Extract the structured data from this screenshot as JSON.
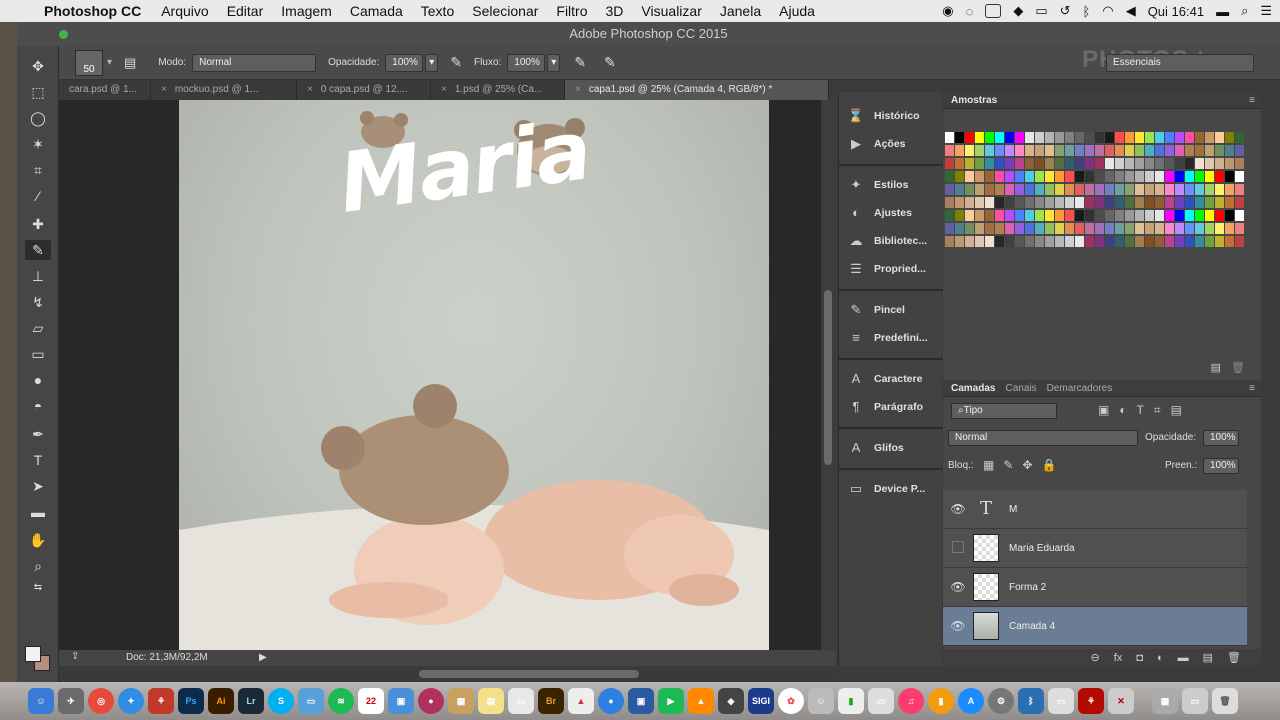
{
  "menubar": {
    "app": "Photoshop CC",
    "items": [
      "Arquivo",
      "Editar",
      "Imagem",
      "Camada",
      "Texto",
      "Selecionar",
      "Filtro",
      "3D",
      "Visualizar",
      "Janela",
      "Ajuda"
    ],
    "clock": "Qui 16:41"
  },
  "window": {
    "title": "Adobe Photoshop CC 2015"
  },
  "options": {
    "brush_size": "50",
    "mode_label": "Modo:",
    "mode_value": "Normal",
    "opacity_label": "Opacidade:",
    "opacity_value": "100%",
    "flow_label": "Fluxo:",
    "flow_value": "100%",
    "workspace": "Essenciais",
    "logo": "PHOTOS tv"
  },
  "tabs": [
    {
      "label": "cara.psd @ 1..."
    },
    {
      "label": "mockuo.psd @ 1..."
    },
    {
      "label": "0 capa.psd @ 12,..."
    },
    {
      "label": "1.psd @ 25% (Ca..."
    },
    {
      "label": "capa1.psd @ 25% (Camada 4, RGB/8*) *"
    }
  ],
  "canvas": {
    "text": "Maria"
  },
  "status": {
    "doc": "Doc: 21,3M/92,2M"
  },
  "panel_column": [
    {
      "label": "Histórico",
      "icon": "history-icon",
      "glyph": "⌛"
    },
    {
      "label": "Ações",
      "icon": "actions-play-icon",
      "glyph": "▶"
    },
    {
      "label": "Estilos",
      "icon": "styles-icon",
      "glyph": "✦"
    },
    {
      "label": "Ajustes",
      "icon": "adjustments-icon",
      "glyph": "◐"
    },
    {
      "label": "Bibliotec...",
      "icon": "libraries-icon",
      "glyph": "☁"
    },
    {
      "label": "Propried...",
      "icon": "properties-icon",
      "glyph": "☰"
    },
    {
      "label": "Pincel",
      "icon": "brush-icon",
      "glyph": "✎"
    },
    {
      "label": "Predefini...",
      "icon": "brush-presets-icon",
      "glyph": "≡"
    },
    {
      "label": "Caractere",
      "icon": "character-icon",
      "glyph": "A"
    },
    {
      "label": "Parágrafo",
      "icon": "paragraph-icon",
      "glyph": "¶"
    },
    {
      "label": "Glifos",
      "icon": "glyphs-icon",
      "glyph": "A"
    },
    {
      "label": "Device P...",
      "icon": "device-preview-icon",
      "glyph": "▭"
    }
  ],
  "swatches": {
    "title": "Amostras"
  },
  "layers": {
    "tabs": [
      "Camadas",
      "Canais",
      "Demarcadores"
    ],
    "filter": "Tipo",
    "blend": "Normal",
    "opacity_label": "Opacidade:",
    "opacity_value": "100%",
    "lock_label": "Bloq.:",
    "fill_label": "Preen.:",
    "fill_value": "100%",
    "items": [
      {
        "name": "M",
        "type": "text",
        "visible": true,
        "selected": false
      },
      {
        "name": "Maria Eduarda",
        "type": "layer",
        "visible": false,
        "selected": false
      },
      {
        "name": "Forma 2",
        "type": "layer",
        "visible": true,
        "selected": false
      },
      {
        "name": "Camada 4",
        "type": "photo",
        "visible": true,
        "selected": true
      }
    ]
  },
  "colors": {
    "foreground": "#f2f2f2",
    "background": "#b58e80",
    "selected_layer": "#6a7d94"
  }
}
